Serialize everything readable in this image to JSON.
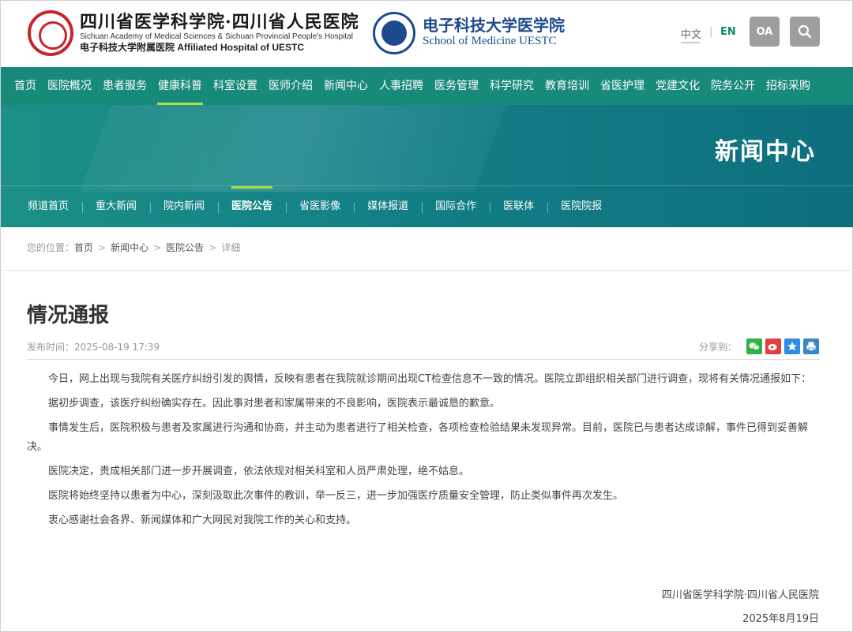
{
  "header": {
    "logo1": {
      "cn": "四川省医学科学院·四川省人民医院",
      "en": "Sichuan Academy of Medical Sciences & Sichuan Provincial People's Hospital",
      "sub": "电子科技大学附属医院 Affiliated Hospital of UESTC"
    },
    "logo2": {
      "cn": "电子科技大学医学院",
      "en": "School of Medicine UESTC"
    },
    "lang_cn": "中文",
    "lang_sep": "|",
    "lang_en": "EN",
    "oa_label": "OA",
    "search_icon": "search-icon"
  },
  "main_nav": [
    {
      "label": "首页"
    },
    {
      "label": "医院概况"
    },
    {
      "label": "患者服务"
    },
    {
      "label": "健康科普"
    },
    {
      "label": "科室设置"
    },
    {
      "label": "医师介绍"
    },
    {
      "label": "新闻中心"
    },
    {
      "label": "人事招聘"
    },
    {
      "label": "医务管理"
    },
    {
      "label": "科学研究"
    },
    {
      "label": "教育培训"
    },
    {
      "label": "省医护理"
    },
    {
      "label": "党建文化"
    },
    {
      "label": "院务公开"
    },
    {
      "label": "招标采购"
    }
  ],
  "main_nav_active": 3,
  "banner": {
    "title": "新闻中心",
    "sub_nav": [
      {
        "label": "频道首页"
      },
      {
        "label": "重大新闻"
      },
      {
        "label": "院内新闻"
      },
      {
        "label": "医院公告"
      },
      {
        "label": "省医影像"
      },
      {
        "label": "媒体报道"
      },
      {
        "label": "国际合作"
      },
      {
        "label": "医联体"
      },
      {
        "label": "医院院报"
      }
    ],
    "sub_nav_active": 3
  },
  "breadcrumb": {
    "prefix": "您的位置：",
    "items": [
      "首页",
      "新闻中心",
      "医院公告",
      "详细"
    ],
    "separator": ">"
  },
  "article": {
    "title": "情况通报",
    "publish_time": "发布时间：2025-08-19 17:39",
    "share_label": "分享到：",
    "share_icons": [
      "wechat-icon",
      "weibo-icon",
      "qzone-icon",
      "print-icon"
    ],
    "paragraphs": [
      "今日，网上出现与我院有关医疗纠纷引发的舆情，反映有患者在我院就诊期间出现CT检查信息不一致的情况。医院立即组织相关部门进行调查，现将有关情况通报如下：",
      "据初步调查，该医疗纠纷确实存在。因此事对患者和家属带来的不良影响，医院表示最诚恳的歉意。",
      "事情发生后，医院积极与患者及家属进行沟通和协商，并主动为患者进行了相关检查，各项检查检验结果未发现异常。目前，医院已与患者达成谅解，事件已得到妥善解决。",
      "医院决定，责成相关部门进一步开展调查，依法依规对相关科室和人员严肃处理，绝不姑息。",
      "医院将始终坚持以患者为中心，深刻汲取此次事件的教训，举一反三，进一步加强医疗质量安全管理，防止类似事件再次发生。",
      "衷心感谢社会各界、新闻媒体和广大网民对我院工作的关心和支持。"
    ],
    "signature": "四川省医学科学院·四川省人民医院",
    "date": "2025年8月19日"
  },
  "colors": {
    "nav_bg": "#178a7a",
    "accent": "#a8e04a",
    "lang_en": "#0f8a66",
    "logo1": "#c8242b",
    "logo2": "#1d4a8e"
  }
}
